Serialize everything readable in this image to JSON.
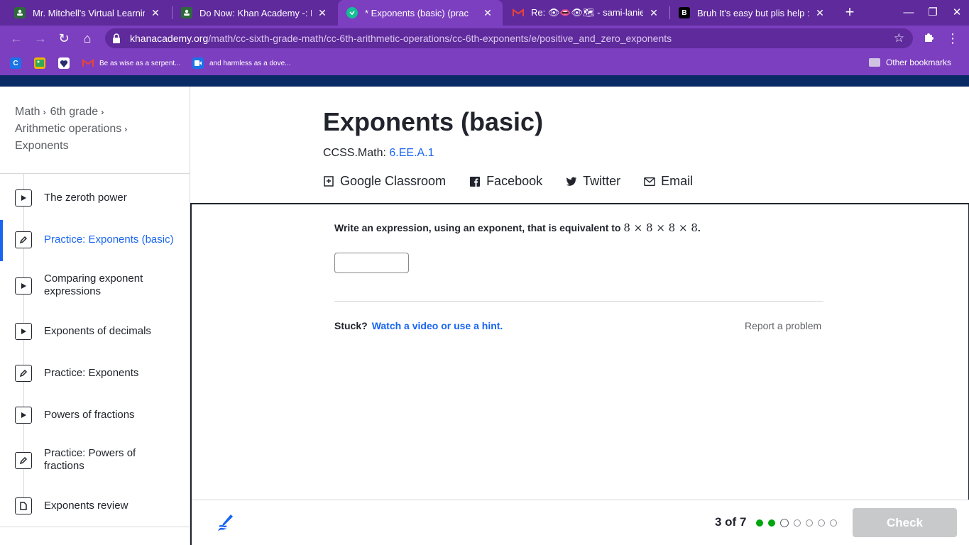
{
  "browser": {
    "tabs": [
      {
        "title": "Mr. Mitchell's Virtual Learning",
        "favicon": "classroom-icon",
        "active": false
      },
      {
        "title": "Do Now: Khan Academy -: Exp",
        "favicon": "classroom-icon",
        "active": false
      },
      {
        "title": "* Exponents (basic) (prac",
        "favicon": "khan-academy-icon",
        "active": true
      },
      {
        "title": "Re: 👁👄👁🗺 - sami-lanier@",
        "favicon": "gmail-icon",
        "active": false
      },
      {
        "title": "Bruh It's easy but plis help :/ -",
        "favicon": "brainly-icon",
        "active": false
      }
    ],
    "url_host": "khanacademy.org",
    "url_path": "/math/cc-sixth-grade-math/cc-6th-arithmetic-operations/cc-6th-exponents/e/positive_and_zero_exponents",
    "bookmarks": [
      {
        "label": "",
        "icon": "c-icon"
      },
      {
        "label": "",
        "icon": "photo-icon"
      },
      {
        "label": "",
        "icon": "heart-icon"
      },
      {
        "label": "Be as wise as a serpent...",
        "icon": "gmail-icon"
      },
      {
        "label": "and harmless as a dove...",
        "icon": "meet-icon"
      }
    ],
    "other_bookmarks": "Other bookmarks",
    "accent": "#7c3fbf"
  },
  "sidebar": {
    "breadcrumbs": [
      "Math",
      "6th grade",
      "Arithmetic operations",
      "Exponents"
    ],
    "items": [
      {
        "label": "The zeroth power",
        "type": "video",
        "active": false
      },
      {
        "label": "Practice: Exponents (basic)",
        "type": "practice",
        "active": true
      },
      {
        "label": "Comparing exponent expressions",
        "type": "video",
        "active": false
      },
      {
        "label": "Exponents of decimals",
        "type": "video",
        "active": false
      },
      {
        "label": "Practice: Exponents",
        "type": "practice",
        "active": false
      },
      {
        "label": "Powers of fractions",
        "type": "video",
        "active": false
      },
      {
        "label": "Practice: Powers of fractions",
        "type": "practice",
        "active": false
      },
      {
        "label": "Exponents review",
        "type": "article",
        "active": false
      }
    ]
  },
  "header": {
    "title": "Exponents (basic)",
    "standard_prefix": "CCSS.Math:",
    "standard_code": "6.EE.A.1",
    "share": {
      "classroom": "Google Classroom",
      "facebook": "Facebook",
      "twitter": "Twitter",
      "email": "Email"
    }
  },
  "exercise": {
    "question_text": "Write an expression, using an exponent, that is equivalent to",
    "question_math": "8 × 8 × 8 × 8",
    "question_end": ".",
    "answer_value": "",
    "stuck_label": "Stuck?",
    "hint_link": "Watch a video or use a hint.",
    "report": "Report a problem",
    "progress_label": "3 of 7",
    "progress": {
      "current": 3,
      "total": 7,
      "completed": 2
    },
    "check_label": "Check"
  },
  "colors": {
    "link": "#1865f2",
    "text": "#21242c",
    "success": "#00a60e",
    "disabled_button": "#c8c9cb",
    "khan_navbar": "#0a2a66"
  }
}
